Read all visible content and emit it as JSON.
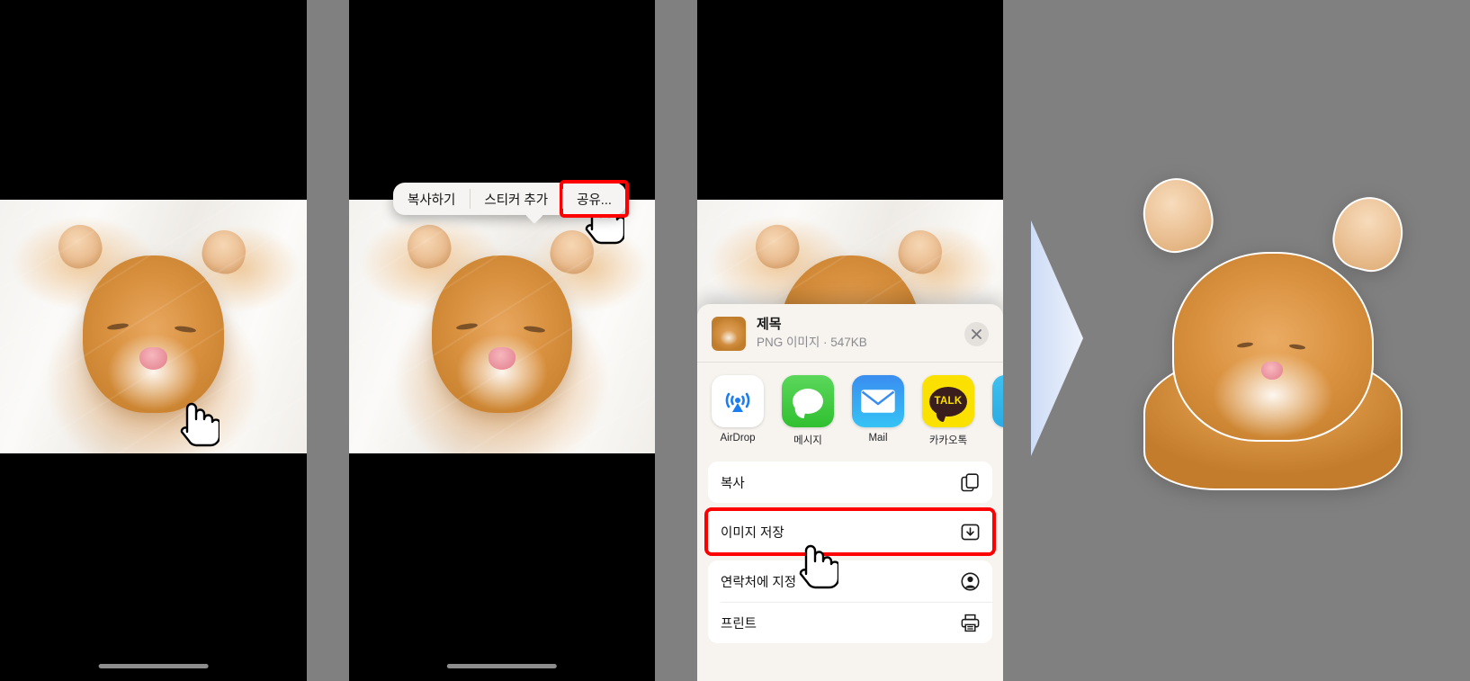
{
  "panels": [
    {
      "name": "panel-photo-view",
      "screen_background": "#000000",
      "cursor": "pointer-hand-cursor",
      "home_indicator": true
    },
    {
      "name": "panel-context-menu",
      "screen_background": "#000000",
      "context_menu": {
        "items": [
          {
            "label": "복사하기",
            "highlighted": false
          },
          {
            "label": "스티커 추가",
            "highlighted": false
          },
          {
            "label": "공유...",
            "highlighted": true
          }
        ]
      }
    },
    {
      "name": "panel-share-sheet",
      "screen_background": "#000000"
    }
  ],
  "share_sheet": {
    "header": {
      "title": "제목",
      "subtitle": "PNG 이미지 · 547KB",
      "thumbnail": "image-thumbnail",
      "close_label": "×"
    },
    "apps": [
      {
        "label": "AirDrop",
        "icon": "airdrop-icon",
        "color": "#007aff"
      },
      {
        "label": "메시지",
        "icon": "messages-icon",
        "color": "#30c030"
      },
      {
        "label": "Mail",
        "icon": "mail-icon",
        "color": "#3a8df0"
      },
      {
        "label": "카카오톡",
        "icon": "kakaotalk-icon",
        "color": "#fae100",
        "badge_text": "TALK"
      },
      {
        "label": "",
        "icon": "telegram-icon",
        "color": "#2aabe2"
      }
    ],
    "actions": [
      {
        "label": "복사",
        "icon": "copy-icon",
        "highlighted": false
      },
      {
        "label": "이미지 저장",
        "icon": "save-download-icon",
        "highlighted": true
      },
      {
        "label": "연락처에 지정",
        "icon": "contact-person-icon",
        "highlighted": false
      },
      {
        "label": "프린트",
        "icon": "printer-icon",
        "highlighted": false
      }
    ]
  },
  "transition": {
    "arrow": "right-arrow-gradient",
    "arrow_color_start": "#cddcf6",
    "arrow_color_end": "#eef3fc"
  },
  "result": {
    "name": "cutout-sticker-cat",
    "description": "배경이 제거된 고양이 스티커"
  },
  "theme": {
    "page_background": "#808080",
    "highlight_color": "#ff0000",
    "sheet_background": "#f7f4f0",
    "row_background": "#ffffff"
  }
}
